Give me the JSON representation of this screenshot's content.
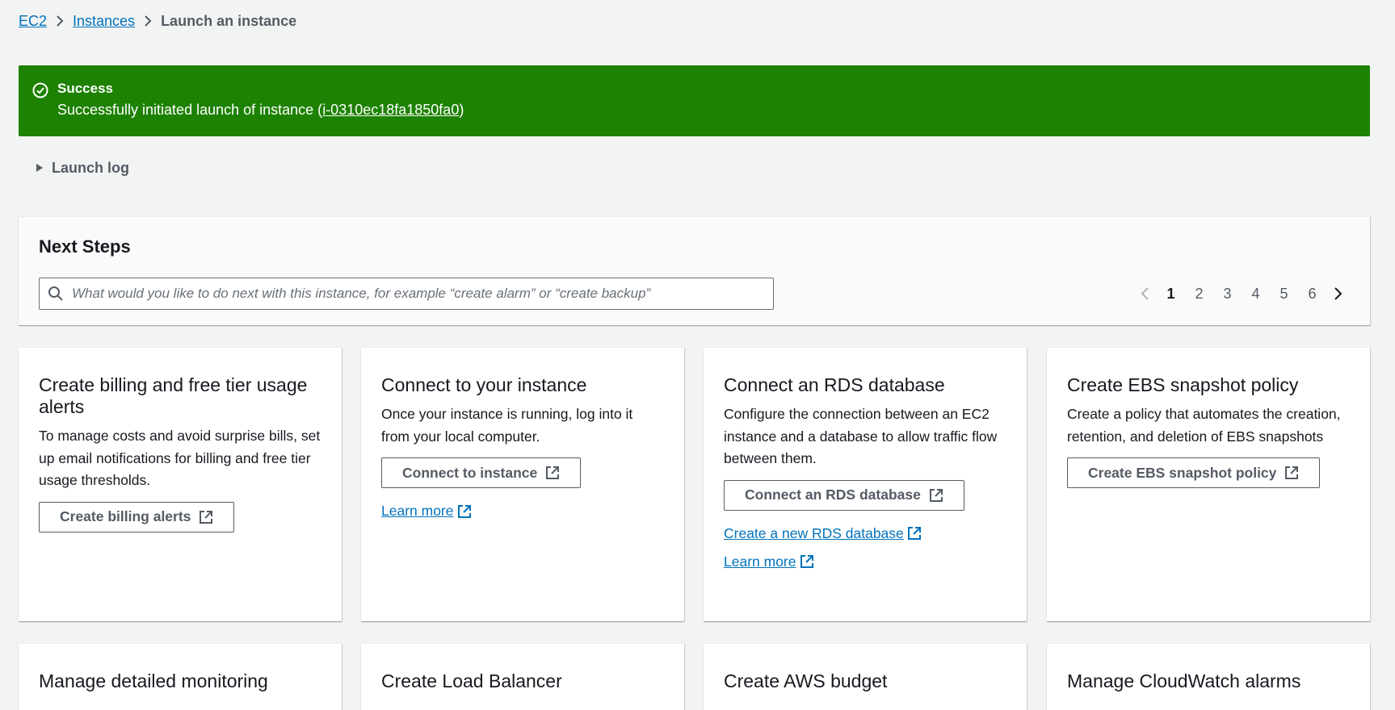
{
  "breadcrumb": {
    "items": [
      "EC2",
      "Instances"
    ],
    "current": "Launch an instance"
  },
  "flash": {
    "title": "Success",
    "message_prefix": "Successfully initiated launch of instance (",
    "instance_id": "i-0310ec18fa1850fa0",
    "message_suffix": ")",
    "color": "#1d8102"
  },
  "launch_log": {
    "label": "Launch log"
  },
  "next_steps": {
    "title": "Next Steps",
    "search_placeholder": "What would you like to do next with this instance, for example “create alarm” or “create backup”",
    "pages": [
      "1",
      "2",
      "3",
      "4",
      "5",
      "6"
    ],
    "current_page": "1"
  },
  "cards": [
    {
      "title": "Create billing and free tier usage alerts",
      "description": "To manage costs and avoid surprise bills, set up email notifications for billing and free tier usage thresholds.",
      "button": "Create billing alerts"
    },
    {
      "title": "Connect to your instance",
      "description": "Once your instance is running, log into it from your local computer.",
      "button": "Connect to instance",
      "link": "Learn more"
    },
    {
      "title": "Connect an RDS database",
      "description": "Configure the connection between an EC2 instance and a database to allow traffic flow between them.",
      "button": "Connect an RDS database",
      "link": "Create a new RDS database",
      "link2": "Learn more"
    },
    {
      "title": "Create EBS snapshot policy",
      "description": "Create a policy that automates the creation, retention, and deletion of EBS snapshots",
      "button": "Create EBS snapshot policy"
    },
    {
      "title": "Manage detailed monitoring"
    },
    {
      "title": "Create Load Balancer"
    },
    {
      "title": "Create AWS budget"
    },
    {
      "title": "Manage CloudWatch alarms"
    }
  ],
  "colors": {
    "link": "#0073bb",
    "page_bg": "#f2f3f3",
    "button_border": "#545b64"
  },
  "icons": [
    "chevron-right-icon",
    "check-circle-icon",
    "caret-right-icon",
    "search-icon",
    "chevron-left-icon",
    "external-link-icon"
  ]
}
